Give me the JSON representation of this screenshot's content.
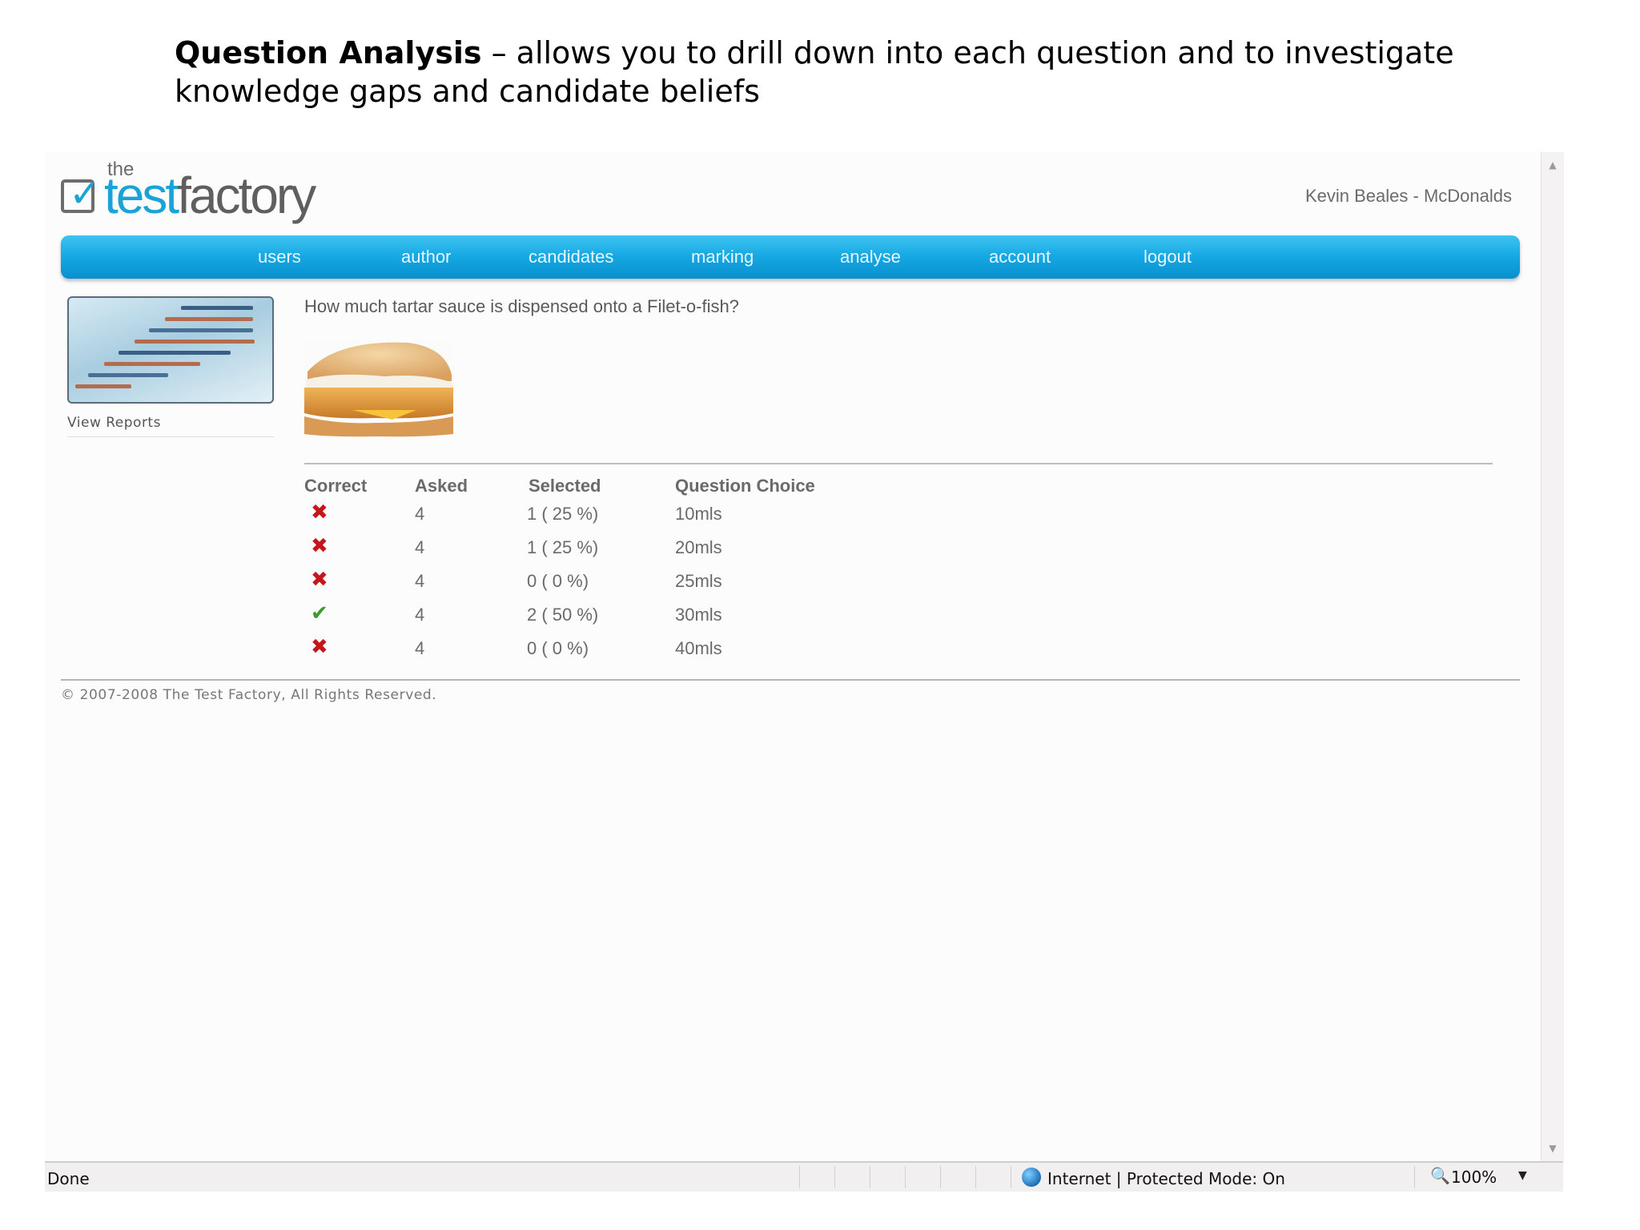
{
  "slide": {
    "caption_bold": "Question Analysis",
    "caption_rest": " – allows you to drill down into each question and to investigate knowledge gaps and candidate beliefs"
  },
  "header": {
    "logo_the": "the",
    "logo_test": "test",
    "logo_factory": "factory",
    "user": "Kevin Beales - McDonalds"
  },
  "nav": {
    "items": [
      "users",
      "author",
      "candidates",
      "marking",
      "analyse",
      "account",
      "logout"
    ]
  },
  "sidebar": {
    "reports_label": "View Reports"
  },
  "question": {
    "text": "How much tartar sauce is dispensed onto a Filet-o-fish?"
  },
  "table": {
    "headers": [
      "Correct",
      "Asked",
      "Selected",
      "Question Choice"
    ],
    "rows": [
      {
        "correct": false,
        "icon": "cross-icon",
        "asked": "4",
        "selected": "1 ( 25 %)",
        "choice": "10mls"
      },
      {
        "correct": false,
        "icon": "cross-icon",
        "asked": "4",
        "selected": "1 ( 25 %)",
        "choice": "20mls"
      },
      {
        "correct": false,
        "icon": "cross-icon",
        "asked": "4",
        "selected": "0 ( 0 %)",
        "choice": "25mls"
      },
      {
        "correct": true,
        "icon": "check-icon",
        "asked": "4",
        "selected": "2 ( 50 %)",
        "choice": "30mls"
      },
      {
        "correct": false,
        "icon": "cross-icon",
        "asked": "4",
        "selected": "0 ( 0 %)",
        "choice": "40mls"
      }
    ]
  },
  "footer": {
    "copyright": "© 2007-2008 The Test Factory, All Rights Reserved."
  },
  "statusbar": {
    "status": "Done",
    "zone": "Internet | Protected Mode: On",
    "zoom": "100%"
  },
  "colors": {
    "nav_blue": "#14a8e3",
    "logo_blue": "#1aa3d6",
    "cross_red": "#c4161c",
    "check_green": "#3b9b2e"
  }
}
